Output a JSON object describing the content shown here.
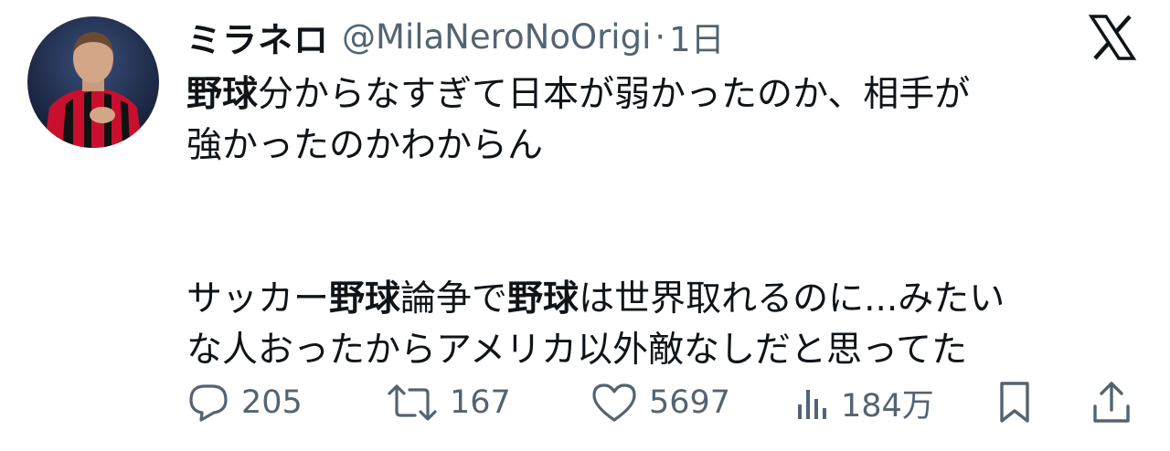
{
  "tweet": {
    "author": {
      "display_name": "ミラネロ",
      "handle": "@MilaNeroNoOrigi",
      "separator": "·",
      "time": "1日"
    },
    "text": {
      "p1_l1_bold": "野球",
      "p1_l1_rest": "分からなすぎて日本が弱かったのか、相手が",
      "p1_l2": "強かったのかわからん",
      "p2_l1_a": "サッカー",
      "p2_l1_b": "野球",
      "p2_l1_c": "論争で",
      "p2_l1_d": "野球",
      "p2_l1_e": "は世界取れるのに...みたい",
      "p2_l2": "な人おったからアメリカ以外敵なしだと思ってた"
    },
    "actions": {
      "replies": "205",
      "retweets": "167",
      "likes": "5697",
      "views": "184万"
    },
    "icons": {
      "platform_logo": "x-logo-icon",
      "reply": "speech-bubble-icon",
      "retweet": "retweet-arrows-icon",
      "like": "heart-icon",
      "views": "bar-chart-icon",
      "bookmark": "bookmark-icon",
      "share": "share-upload-icon"
    },
    "colors": {
      "text": "#0f1419",
      "secondary": "#536471",
      "avatar_jersey_red": "#c8102e",
      "avatar_background": "#1b2a4a"
    }
  }
}
